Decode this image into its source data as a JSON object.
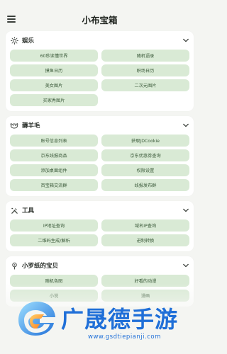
{
  "app": {
    "title": "小布宝箱"
  },
  "sections": [
    {
      "title": "娱乐",
      "icon": "sun-icon",
      "items": [
        "60秒读懂世界",
        "随机语录",
        "摸鱼日历",
        "职场日历",
        "美女图片",
        "二次元图片",
        "买家秀图片"
      ]
    },
    {
      "title": "薅羊毛",
      "icon": "sheep-icon",
      "items": [
        "账号信息列表",
        "获取JDCookie",
        "京东线报商品",
        "京东优惠券查询",
        "添加桌面组件",
        "权限设置",
        "百宝箱交流群",
        "线报发布群"
      ]
    },
    {
      "title": "工具",
      "icon": "tools-icon",
      "items": [
        "IP地址查询",
        "域名IP查询",
        "二维码生成/解析",
        "进制转换"
      ]
    },
    {
      "title": "小罗纸的宝贝",
      "icon": "pin-icon",
      "items": [
        "随机色图",
        "好看的动漫",
        "小说",
        "漫画"
      ]
    }
  ],
  "watermark": {
    "title": "广晟德手游",
    "url": "www.gsdtiepianji.com"
  },
  "colors": {
    "chip_bg": "#d9ead5",
    "chip_text": "#3b5a3a",
    "page_bg": "#f4f5f2",
    "watermark": "#1f6fd8"
  }
}
